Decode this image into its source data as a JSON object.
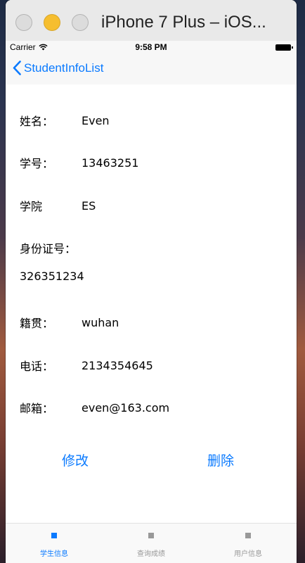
{
  "window": {
    "title": "iPhone 7 Plus – iOS..."
  },
  "status_bar": {
    "carrier": "Carrier",
    "time": "9:58 PM"
  },
  "nav": {
    "back_label": "StudentInfoList"
  },
  "student": {
    "name_label": "姓名：",
    "name_value": "Even",
    "id_label": "学号：",
    "id_value": "13463251",
    "college_label": "学院",
    "college_value": "ES",
    "idcard_label": "身份证号：",
    "idcard_value": "326351234",
    "hometown_label": "籍贯：",
    "hometown_value": "wuhan",
    "phone_label": "电话：",
    "phone_value": "2134354645",
    "email_label": "邮箱：",
    "email_value": "even@163.com"
  },
  "actions": {
    "edit_label": "修改",
    "delete_label": "删除"
  },
  "tabs": [
    {
      "label": "学生信息",
      "active": true
    },
    {
      "label": "查询成绩",
      "active": false
    },
    {
      "label": "用户信息",
      "active": false
    }
  ],
  "colors": {
    "accent": "#0a7aff",
    "inactive": "#999999"
  }
}
